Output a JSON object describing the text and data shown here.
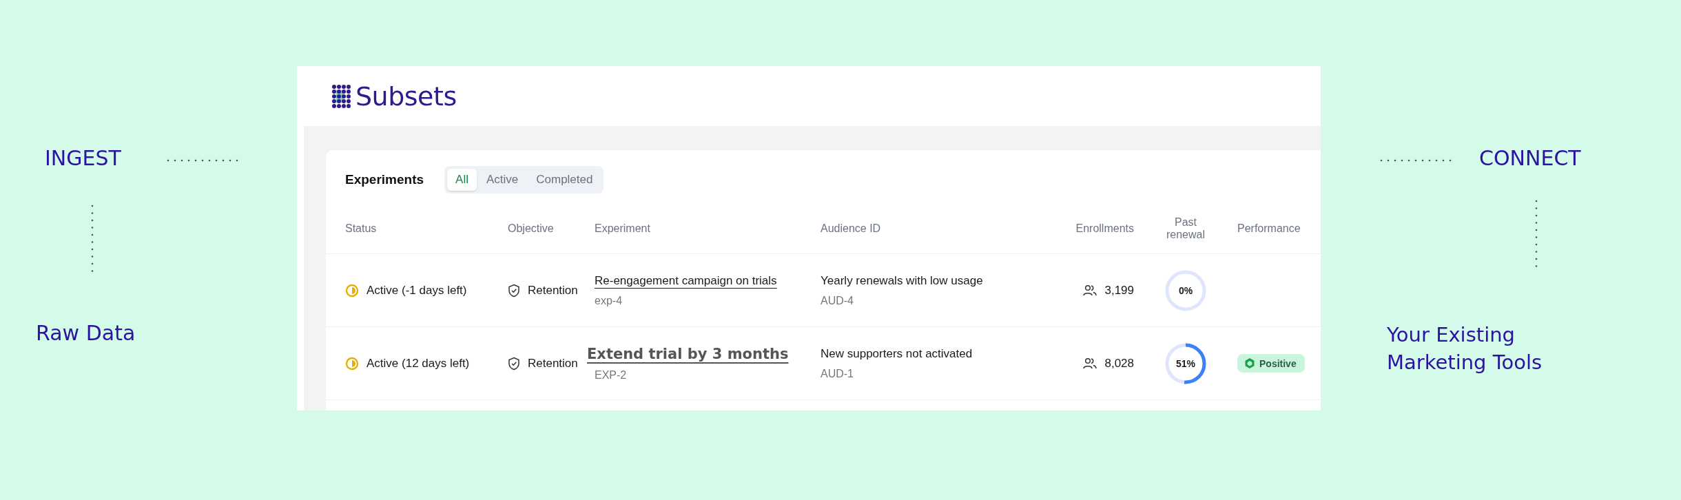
{
  "left": {
    "title": "INGEST",
    "caption": "Raw Data"
  },
  "app": {
    "brand": "Subsets",
    "section_title": "Experiments",
    "tabs": [
      {
        "label": "All",
        "selected": true
      },
      {
        "label": "Active",
        "selected": false
      },
      {
        "label": "Completed",
        "selected": false
      }
    ],
    "table": {
      "columns": [
        "Status",
        "Objective",
        "Experiment",
        "Audience ID",
        "Enrollments",
        "Past renewal",
        "Performance"
      ],
      "rows": [
        {
          "status": "Active (-1 days left)",
          "objective": "Retention",
          "experiment": {
            "kind": "link",
            "title": "Re-engagement campaign on trials",
            "id": "exp-4"
          },
          "audience": {
            "name": "Yearly renewals with low usage",
            "id": "AUD-4"
          },
          "enrollments": "3,199",
          "past_renewal": {
            "level": 0,
            "reading": "0%"
          }
        },
        {
          "status": "Active (12 days left)",
          "objective": "Retention",
          "experiment": {
            "kind": "bold-link",
            "title": "Extend trial by 3 months",
            "id": "EXP-2"
          },
          "audience": {
            "name": "New supporters not activated",
            "id": "AUD-1"
          },
          "enrollments": "8,028",
          "past_renewal": {
            "level": 0.51,
            "reading": "51%"
          },
          "performance": "Positive"
        }
      ]
    }
  },
  "right": {
    "title": "CONNECT",
    "caption": "Your Existing Marketing Tools"
  }
}
